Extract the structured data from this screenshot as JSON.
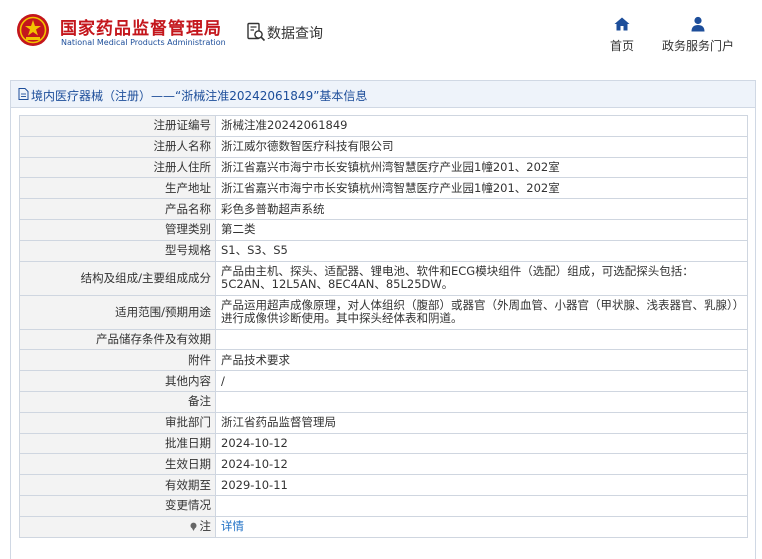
{
  "header": {
    "site_title": "国家药品监督管理局",
    "site_subtitle": "National Medical Products Administration",
    "query_label": "数据查询",
    "nav": [
      {
        "label": "首页",
        "icon": "home-icon"
      },
      {
        "label": "政务服务门户",
        "icon": "user-icon"
      }
    ]
  },
  "panel": {
    "title": "境内医疗器械（注册）——“浙械注准20242061849”基本信息"
  },
  "rows": [
    {
      "key": "注册证编号",
      "value": "浙械注准20242061849"
    },
    {
      "key": "注册人名称",
      "value": "浙江威尔德数智医疗科技有限公司"
    },
    {
      "key": "注册人住所",
      "value": "浙江省嘉兴市海宁市长安镇杭州湾智慧医疗产业园1幢201、202室"
    },
    {
      "key": "生产地址",
      "value": "浙江省嘉兴市海宁市长安镇杭州湾智慧医疗产业园1幢201、202室"
    },
    {
      "key": "产品名称",
      "value": "彩色多普勒超声系统"
    },
    {
      "key": "管理类别",
      "value": "第二类"
    },
    {
      "key": "型号规格",
      "value": "S1、S3、S5"
    },
    {
      "key": "结构及组成/主要组成成分",
      "value": "产品由主机、探头、适配器、锂电池、软件和ECG模块组件（选配）组成，可选配探头包括：5C2AN、12L5AN、8EC4AN、85L25DW。"
    },
    {
      "key": "适用范围/预期用途",
      "value": "产品运用超声成像原理，对人体组织（腹部）或器官（外周血管、小器官（甲状腺、浅表器官、乳腺））进行成像供诊断使用。其中探头经体表和阴道。"
    },
    {
      "key": "产品储存条件及有效期",
      "value": ""
    },
    {
      "key": "附件",
      "value": "产品技术要求"
    },
    {
      "key": "其他内容",
      "value": "/"
    },
    {
      "key": "备注",
      "value": ""
    },
    {
      "key": "审批部门",
      "value": "浙江省药品监督管理局"
    },
    {
      "key": "批准日期",
      "value": "2024-10-12"
    },
    {
      "key": "生效日期",
      "value": "2024-10-12"
    },
    {
      "key": "有效期至",
      "value": "2029-10-11"
    },
    {
      "key": "变更情况",
      "value": ""
    },
    {
      "key": "注",
      "value": "详情"
    }
  ],
  "colors": {
    "brand_red": "#c4161c",
    "brand_blue": "#1d4e9a",
    "link": "#1d6fc4",
    "key_bg": "#f3f3f3",
    "panel_head_bg": "#eef3fa"
  }
}
